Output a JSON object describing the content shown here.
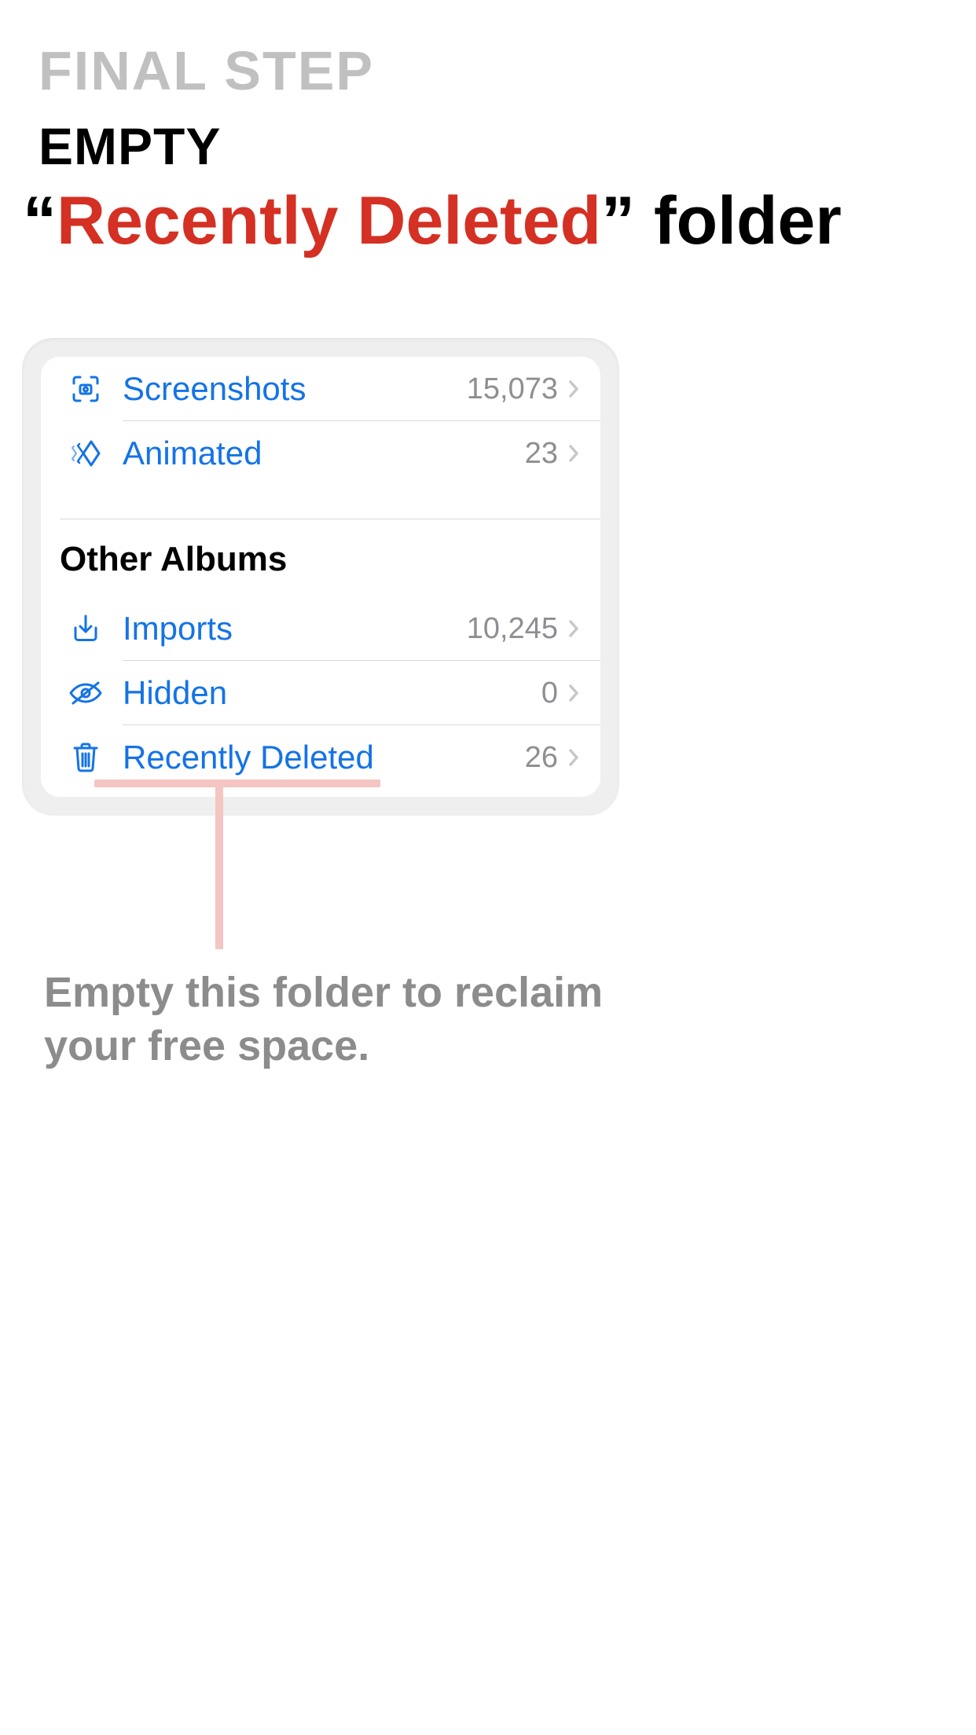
{
  "header": {
    "kicker": "FINAL STEP",
    "line1": "EMPTY",
    "quote_open": "“",
    "highlight": "Recently Deleted",
    "quote_close": "”",
    "trailing": " folder"
  },
  "albums_panel": {
    "top": [
      {
        "icon": "screenshots-icon",
        "label": "Screenshots",
        "count": "15,073"
      },
      {
        "icon": "animated-icon",
        "label": "Animated",
        "count": "23"
      }
    ],
    "section_header": "Other Albums",
    "other": [
      {
        "icon": "imports-icon",
        "label": "Imports",
        "count": "10,245"
      },
      {
        "icon": "hidden-icon",
        "label": "Hidden",
        "count": "0"
      },
      {
        "icon": "trash-icon",
        "label": "Recently Deleted",
        "count": "26"
      }
    ]
  },
  "caption": "Empty this folder to reclaim your free space."
}
